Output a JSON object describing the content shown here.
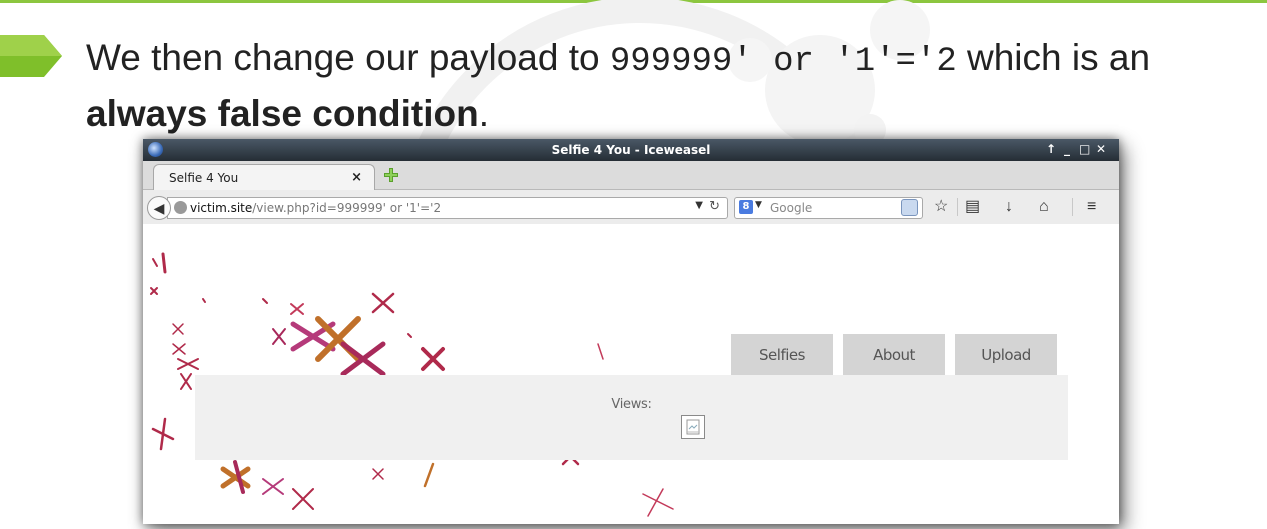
{
  "slide": {
    "headline_prefix": "We then change our payload to ",
    "payload_code": "999999' or '1'='2",
    "headline_middle": " which is an",
    "headline_bold": "always false condition",
    "headline_end": "."
  },
  "colors": {
    "accent_green": "#8cc63f",
    "titlebar": "#2e3740",
    "nav_button_bg": "#d4d4d4",
    "panel_bg": "#f0f0f0"
  },
  "window": {
    "title": "Selfie 4 You - Iceweasel",
    "controls": [
      "↑",
      "_",
      "□",
      "✕"
    ]
  },
  "tab": {
    "label": "Selfie 4 You",
    "close": "×"
  },
  "navbar": {
    "url_host": "victim.site",
    "url_path": "/view.php?id=999999' or '1'='2",
    "search_engine_letter": "8",
    "search_placeholder": "Google",
    "icons": [
      "back-icon",
      "globe-icon",
      "reload-icon",
      "search-engine-icon",
      "magnifier-icon",
      "bookmark-star-icon",
      "reading-list-icon",
      "download-icon",
      "home-icon",
      "menu-icon"
    ]
  },
  "page": {
    "nav": [
      {
        "label": "Selfies"
      },
      {
        "label": "About"
      },
      {
        "label": "Upload"
      }
    ],
    "views_label": "Views:",
    "image_state": "broken-image-icon"
  }
}
